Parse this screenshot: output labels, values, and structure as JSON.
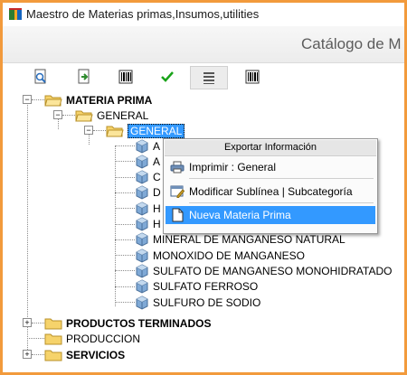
{
  "window": {
    "title": "Maestro de Materias primas,Insumos,utilities"
  },
  "header": {
    "catalog_title": "Catálogo de M"
  },
  "toolbar": {
    "buttons": [
      "preview-icon",
      "export-icon",
      "barcode-icon",
      "check-icon",
      "list-icon",
      "barcode-icon"
    ]
  },
  "tree": {
    "root1": "MATERIA PRIMA",
    "general1": "GENERAL",
    "general2": "GENERAL",
    "items": [
      "A",
      "A",
      "C",
      "D",
      "H",
      "H",
      "MINERAL DE MANGANESO NATURAL",
      "MONOXIDO DE MANGANESO",
      "SULFATO DE MANGANESO MONOHIDRATADO",
      "SULFATO FERROSO",
      "SULFURO DE SODIO"
    ],
    "root2": "PRODUCTOS TERMINADOS",
    "root3": "PRODUCCION",
    "root4": "SERVICIOS"
  },
  "context_menu": {
    "header": "Exportar Información",
    "print": "Imprimir : General",
    "modify": "Modificar Sublínea | Subcategoría",
    "new": "Nueva Materia Prima"
  },
  "colors": {
    "border": "#f29a3c",
    "selection": "#3399ff"
  }
}
